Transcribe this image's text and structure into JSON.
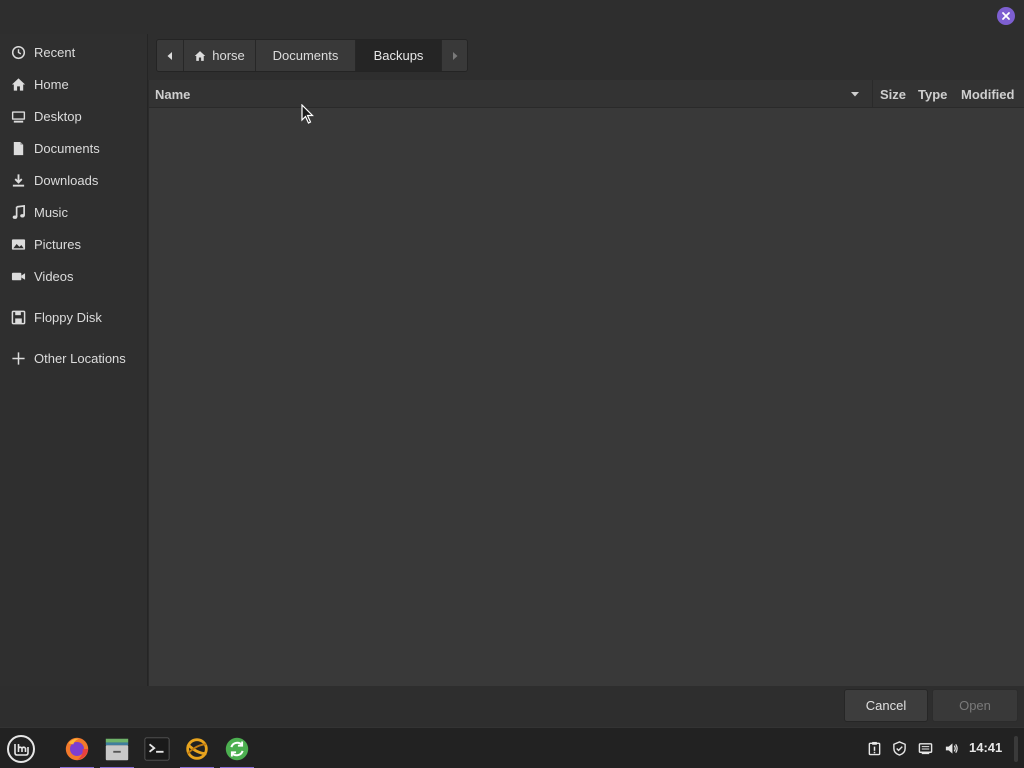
{
  "window": {
    "close_label": "Close"
  },
  "sidebar": {
    "items": [
      {
        "label": "Recent",
        "icon": "clock-icon"
      },
      {
        "label": "Home",
        "icon": "home-icon"
      },
      {
        "label": "Desktop",
        "icon": "desktop-icon"
      },
      {
        "label": "Documents",
        "icon": "document-icon"
      },
      {
        "label": "Downloads",
        "icon": "download-icon"
      },
      {
        "label": "Music",
        "icon": "music-icon"
      },
      {
        "label": "Pictures",
        "icon": "picture-icon"
      },
      {
        "label": "Videos",
        "icon": "video-icon"
      },
      {
        "label": "Floppy Disk",
        "icon": "floppy-icon"
      },
      {
        "label": "Other Locations",
        "icon": "plus-icon"
      }
    ]
  },
  "pathbar": {
    "crumbs": [
      "horse",
      "Documents",
      "Backups"
    ],
    "active": "Backups"
  },
  "filelist": {
    "columns": {
      "name": "Name",
      "size": "Size",
      "type": "Type",
      "modified": "Modified"
    },
    "rows": []
  },
  "actions": {
    "cancel": "Cancel",
    "open": "Open"
  },
  "taskbar": {
    "apps": [
      "mint-menu-icon",
      "firefox-icon",
      "files-icon",
      "terminal-icon",
      "timeshift-icon",
      "update-manager-icon"
    ],
    "clock": "14:41"
  },
  "colors": {
    "accent": "#7d5fd1",
    "background": "#393939",
    "sidebar": "#2f2f2f"
  }
}
